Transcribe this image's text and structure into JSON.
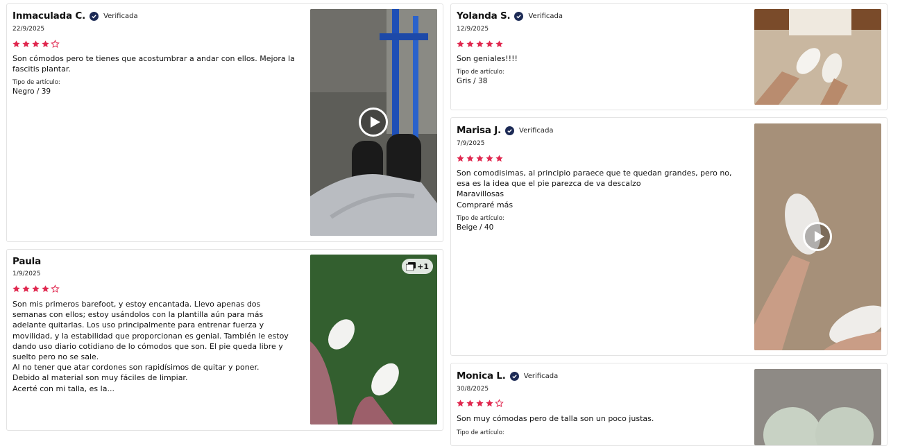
{
  "colors": {
    "star": "#e0284f",
    "badge": "#1c2a55",
    "border": "#e3e3e3"
  },
  "reviews": [
    {
      "name": "Inmaculada C.",
      "verified": "Verificada",
      "date": "22/9/2025",
      "rating": 4,
      "text": "Son cómodos pero te tienes que acostumbrar a andar con ellos. Mejora la fascitis plantar.",
      "item_type_label": "Tipo de artículo:",
      "item_type": "Negro / 39",
      "media": {
        "kind": "video",
        "icon": "play-icon"
      }
    },
    {
      "name": "Paula",
      "verified": "",
      "date": "1/9/2025",
      "rating": 4,
      "text": "Son mis primeros barefoot, y estoy encantada. Llevo apenas dos semanas con ellos; estoy usándolos con la plantilla aún para más adelante quitarlas. Los uso principalmente para entrenar fuerza y movilidad, y la estabilidad que proporcionan es genial. También le estoy dando uso diario cotidiano de lo cómodos que son. El pie queda libre y suelto pero no se sale.\nAl no tener que atar cordones son rapidísimos de quitar y poner.\nDebido al material son muy fáciles de limpiar.\nAcerté con mi talla, es la...",
      "media": {
        "kind": "photo",
        "icon": "gallery-icon",
        "extra_count": "+1"
      }
    },
    {
      "name": "Yolanda S.",
      "verified": "Verificada",
      "date": "12/9/2025",
      "rating": 5,
      "text": "Son geniales!!!!",
      "item_type_label": "Tipo de artículo:",
      "item_type": "Gris / 38",
      "media": {
        "kind": "photo"
      }
    },
    {
      "name": "Marisa J.",
      "verified": "Verificada",
      "date": "7/9/2025",
      "rating": 5,
      "text": "Son comodisimas, al principio paraece que te quedan grandes, pero no, esa es la idea que el pie parezca de va descalzo\nMaravillosas\nCompraré más",
      "item_type_label": "Tipo de artículo:",
      "item_type": "Beige / 40",
      "media": {
        "kind": "video",
        "icon": "play-icon"
      }
    },
    {
      "name": "Monica L.",
      "verified": "Verificada",
      "date": "30/8/2025",
      "rating": 4,
      "text": "Son muy cómodas pero de talla son un poco justas.",
      "item_type_label": "Tipo de artículo:",
      "media": {
        "kind": "photo"
      }
    }
  ]
}
